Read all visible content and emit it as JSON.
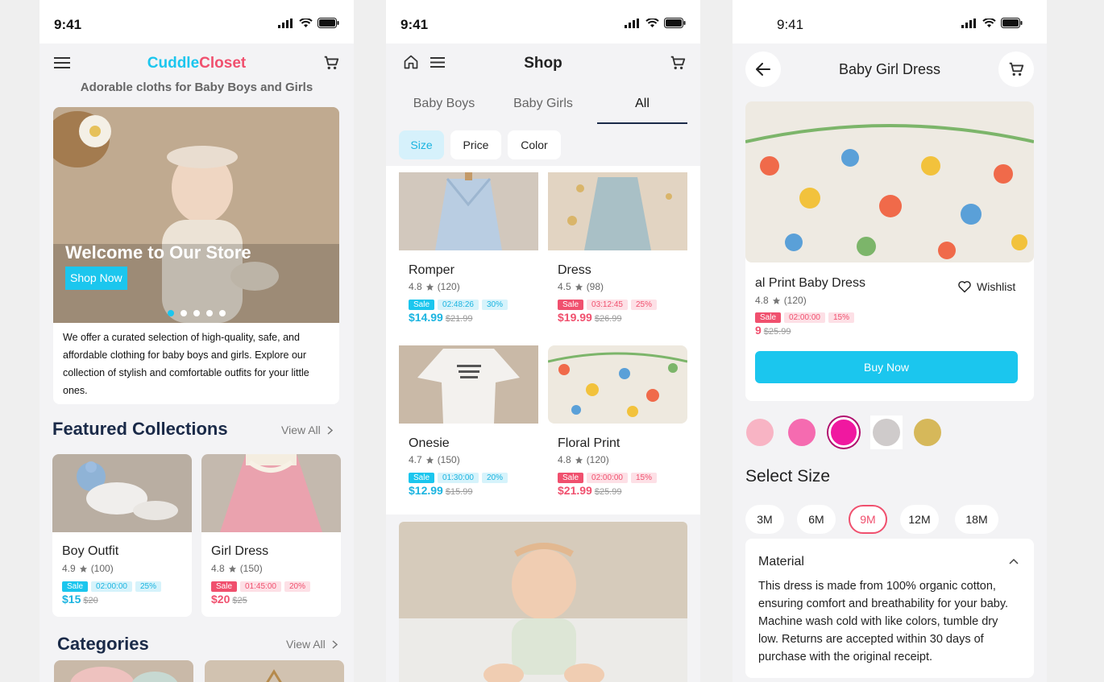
{
  "status": {
    "time": "9:41"
  },
  "home": {
    "brand_a": "Cuddle",
    "brand_b": "Closet",
    "tagline": "Adorable cloths for Baby Boys and Girls",
    "hero_title": "Welcome to Our Store",
    "hero_button": "Shop Now",
    "carousel_dots": 5,
    "intro": "We offer a curated selection of high-quality, safe, and affordable clothing for baby boys and girls. Explore our collection of stylish and comfortable outfits for your little ones.",
    "featured_title": "Featured Collections",
    "view_all": "View All",
    "featured": [
      {
        "name": "Boy Outfit",
        "rating": "4.9",
        "count": "(100)",
        "sale": "Sale",
        "timer": "02:00:00",
        "pct": "25%",
        "price": "$15",
        "old": "$20",
        "theme": "blue"
      },
      {
        "name": "Girl Dress",
        "rating": "4.8",
        "count": "(150)",
        "sale": "Sale",
        "timer": "01:45:00",
        "pct": "20%",
        "price": "$20",
        "old": "$25",
        "theme": "pink"
      }
    ],
    "categories_title": "Categories"
  },
  "shop": {
    "title": "Shop",
    "tabs": [
      "Baby Boys",
      "Baby Girls",
      "All"
    ],
    "active_tab": "All",
    "filters": [
      "Size",
      "Price",
      "Color"
    ],
    "active_filter": "Size",
    "products": [
      {
        "name": "Romper",
        "rating": "4.8",
        "count": "(120)",
        "sale": "Sale",
        "timer": "02:48:26",
        "pct": "30%",
        "price": "$14.99",
        "old": "$21.99",
        "theme": "blue"
      },
      {
        "name": "Dress",
        "rating": "4.5",
        "count": "(98)",
        "sale": "Sale",
        "timer": "03:12:45",
        "pct": "25%",
        "price": "$19.99",
        "old": "$26.99",
        "theme": "pink"
      },
      {
        "name": "Onesie",
        "rating": "4.7",
        "count": "(150)",
        "sale": "Sale",
        "timer": "01:30:00",
        "pct": "20%",
        "price": "$12.99",
        "old": "$15.99",
        "theme": "blue"
      },
      {
        "name": "Floral Print",
        "rating": "4.8",
        "count": "(120)",
        "sale": "Sale",
        "timer": "02:00:00",
        "pct": "15%",
        "price": "$21.99",
        "old": "$25.99",
        "theme": "pink"
      }
    ]
  },
  "detail": {
    "title": "Baby Girl Dress",
    "name": "al Print Baby Dress",
    "rating": "4.8",
    "count": "(120)",
    "sale": "Sale",
    "timer": "02:00:00",
    "pct": "15%",
    "price": "9",
    "old": "$25.99",
    "wishlist": "Wishlist",
    "buy": "Buy Now",
    "swatches": [
      "#f8b4c4",
      "#f56bb0",
      "#f018a0",
      "#cfcbcb",
      "#d6b85a"
    ],
    "selected_swatch": 2,
    "size_title": "Select Size",
    "sizes": [
      "3M",
      "6M",
      "9M",
      "12M",
      "18M"
    ],
    "selected_size": "9M",
    "material_title": "Material",
    "material_text": "This dress is made from 100% organic cotton, ensuring comfort and breathability for your baby. Machine wash cold with like colors, tumble dry low. Returns are accepted within 30 days of purchase with the original receipt."
  },
  "colors": {
    "accent": "#1bc6ee",
    "pink": "#f0506e",
    "dark": "#1a2a48"
  }
}
